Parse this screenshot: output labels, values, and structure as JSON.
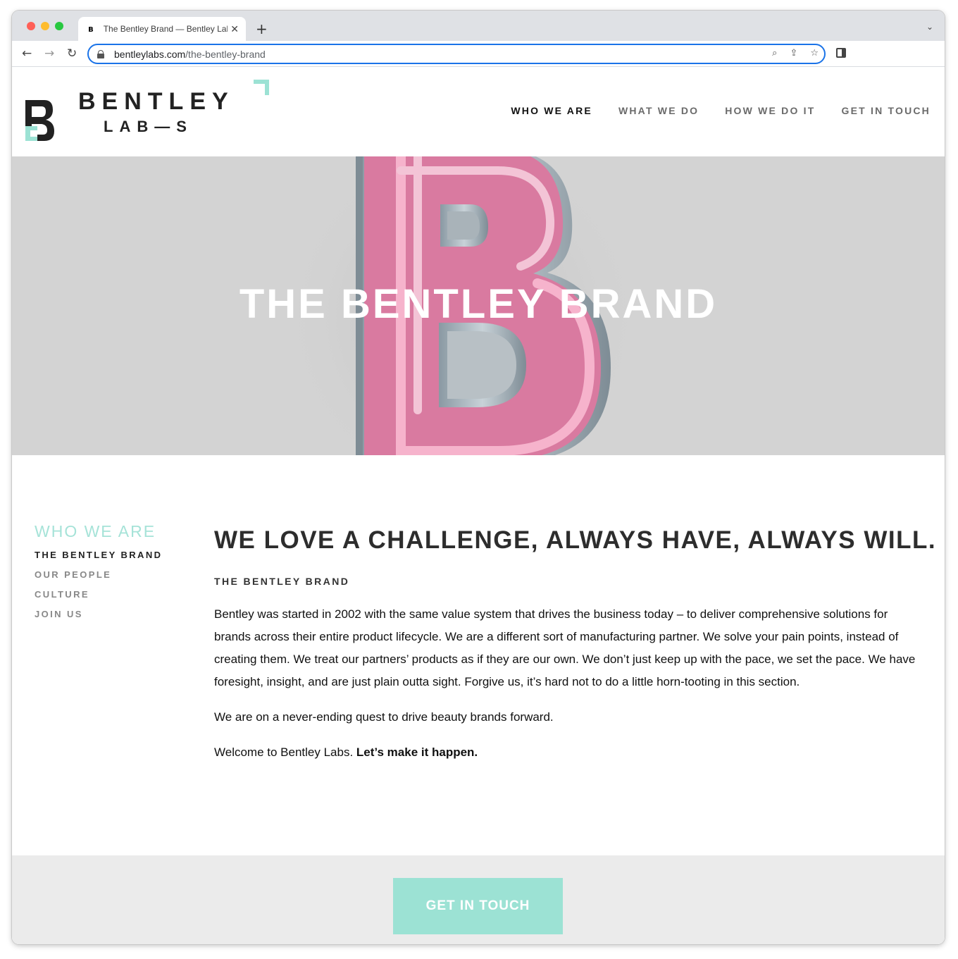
{
  "browser": {
    "tab_title": "The Bentley Brand — Bentley Labs",
    "url_domain": "bentleylabs.com",
    "url_path": "/the-bentley-brand",
    "icons": [
      "back-arrow-icon",
      "forward-arrow-icon",
      "reload-icon",
      "lock-icon",
      "search-icon",
      "share-icon",
      "star-icon",
      "side-panel-icon"
    ]
  },
  "site": {
    "logo_line1": "BENTLEY",
    "logo_line2": "LAB—S",
    "nav": [
      {
        "label": "WHO WE ARE"
      },
      {
        "label": "WHAT WE DO"
      },
      {
        "label": "HOW WE DO IT"
      },
      {
        "label": "GET IN TOUCH"
      }
    ]
  },
  "hero": {
    "title": "THE BENTLEY BRAND"
  },
  "subnav": {
    "heading": "WHO WE ARE",
    "items": [
      {
        "label": "THE BENTLEY BRAND"
      },
      {
        "label": "OUR PEOPLE"
      },
      {
        "label": "CULTURE"
      },
      {
        "label": "JOIN US"
      }
    ]
  },
  "article": {
    "headline": "WE LOVE A CHALLENGE, ALWAYS HAVE, ALWAYS WILL.",
    "kicker": "THE BENTLEY BRAND",
    "paragraph1": "Bentley was started in 2002 with the same value system that drives the business today – to deliver comprehensive solutions for brands across their entire product lifecycle. We are a different sort of manufacturing partner. We solve your pain points, instead of creating them. We treat our partners’ products as if they are our own. We don’t just keep up with the pace, we set the pace. We have foresight, insight, and are just plain outta sight. Forgive us, it’s hard not to do a little horn-tooting in this section.",
    "paragraph2": "We are on a never-ending quest to drive beauty brands forward.",
    "paragraph3_plain": "Welcome to Bentley Labs. ",
    "paragraph3_bold": "Let’s make it happen."
  },
  "cta": {
    "label": "GET IN TOUCH"
  },
  "colors": {
    "accent_mint": "#9ce2d4",
    "hero_bg": "#d3d3d3",
    "neon_pink": "#e07aa2",
    "focus_blue": "#1a73e8"
  }
}
